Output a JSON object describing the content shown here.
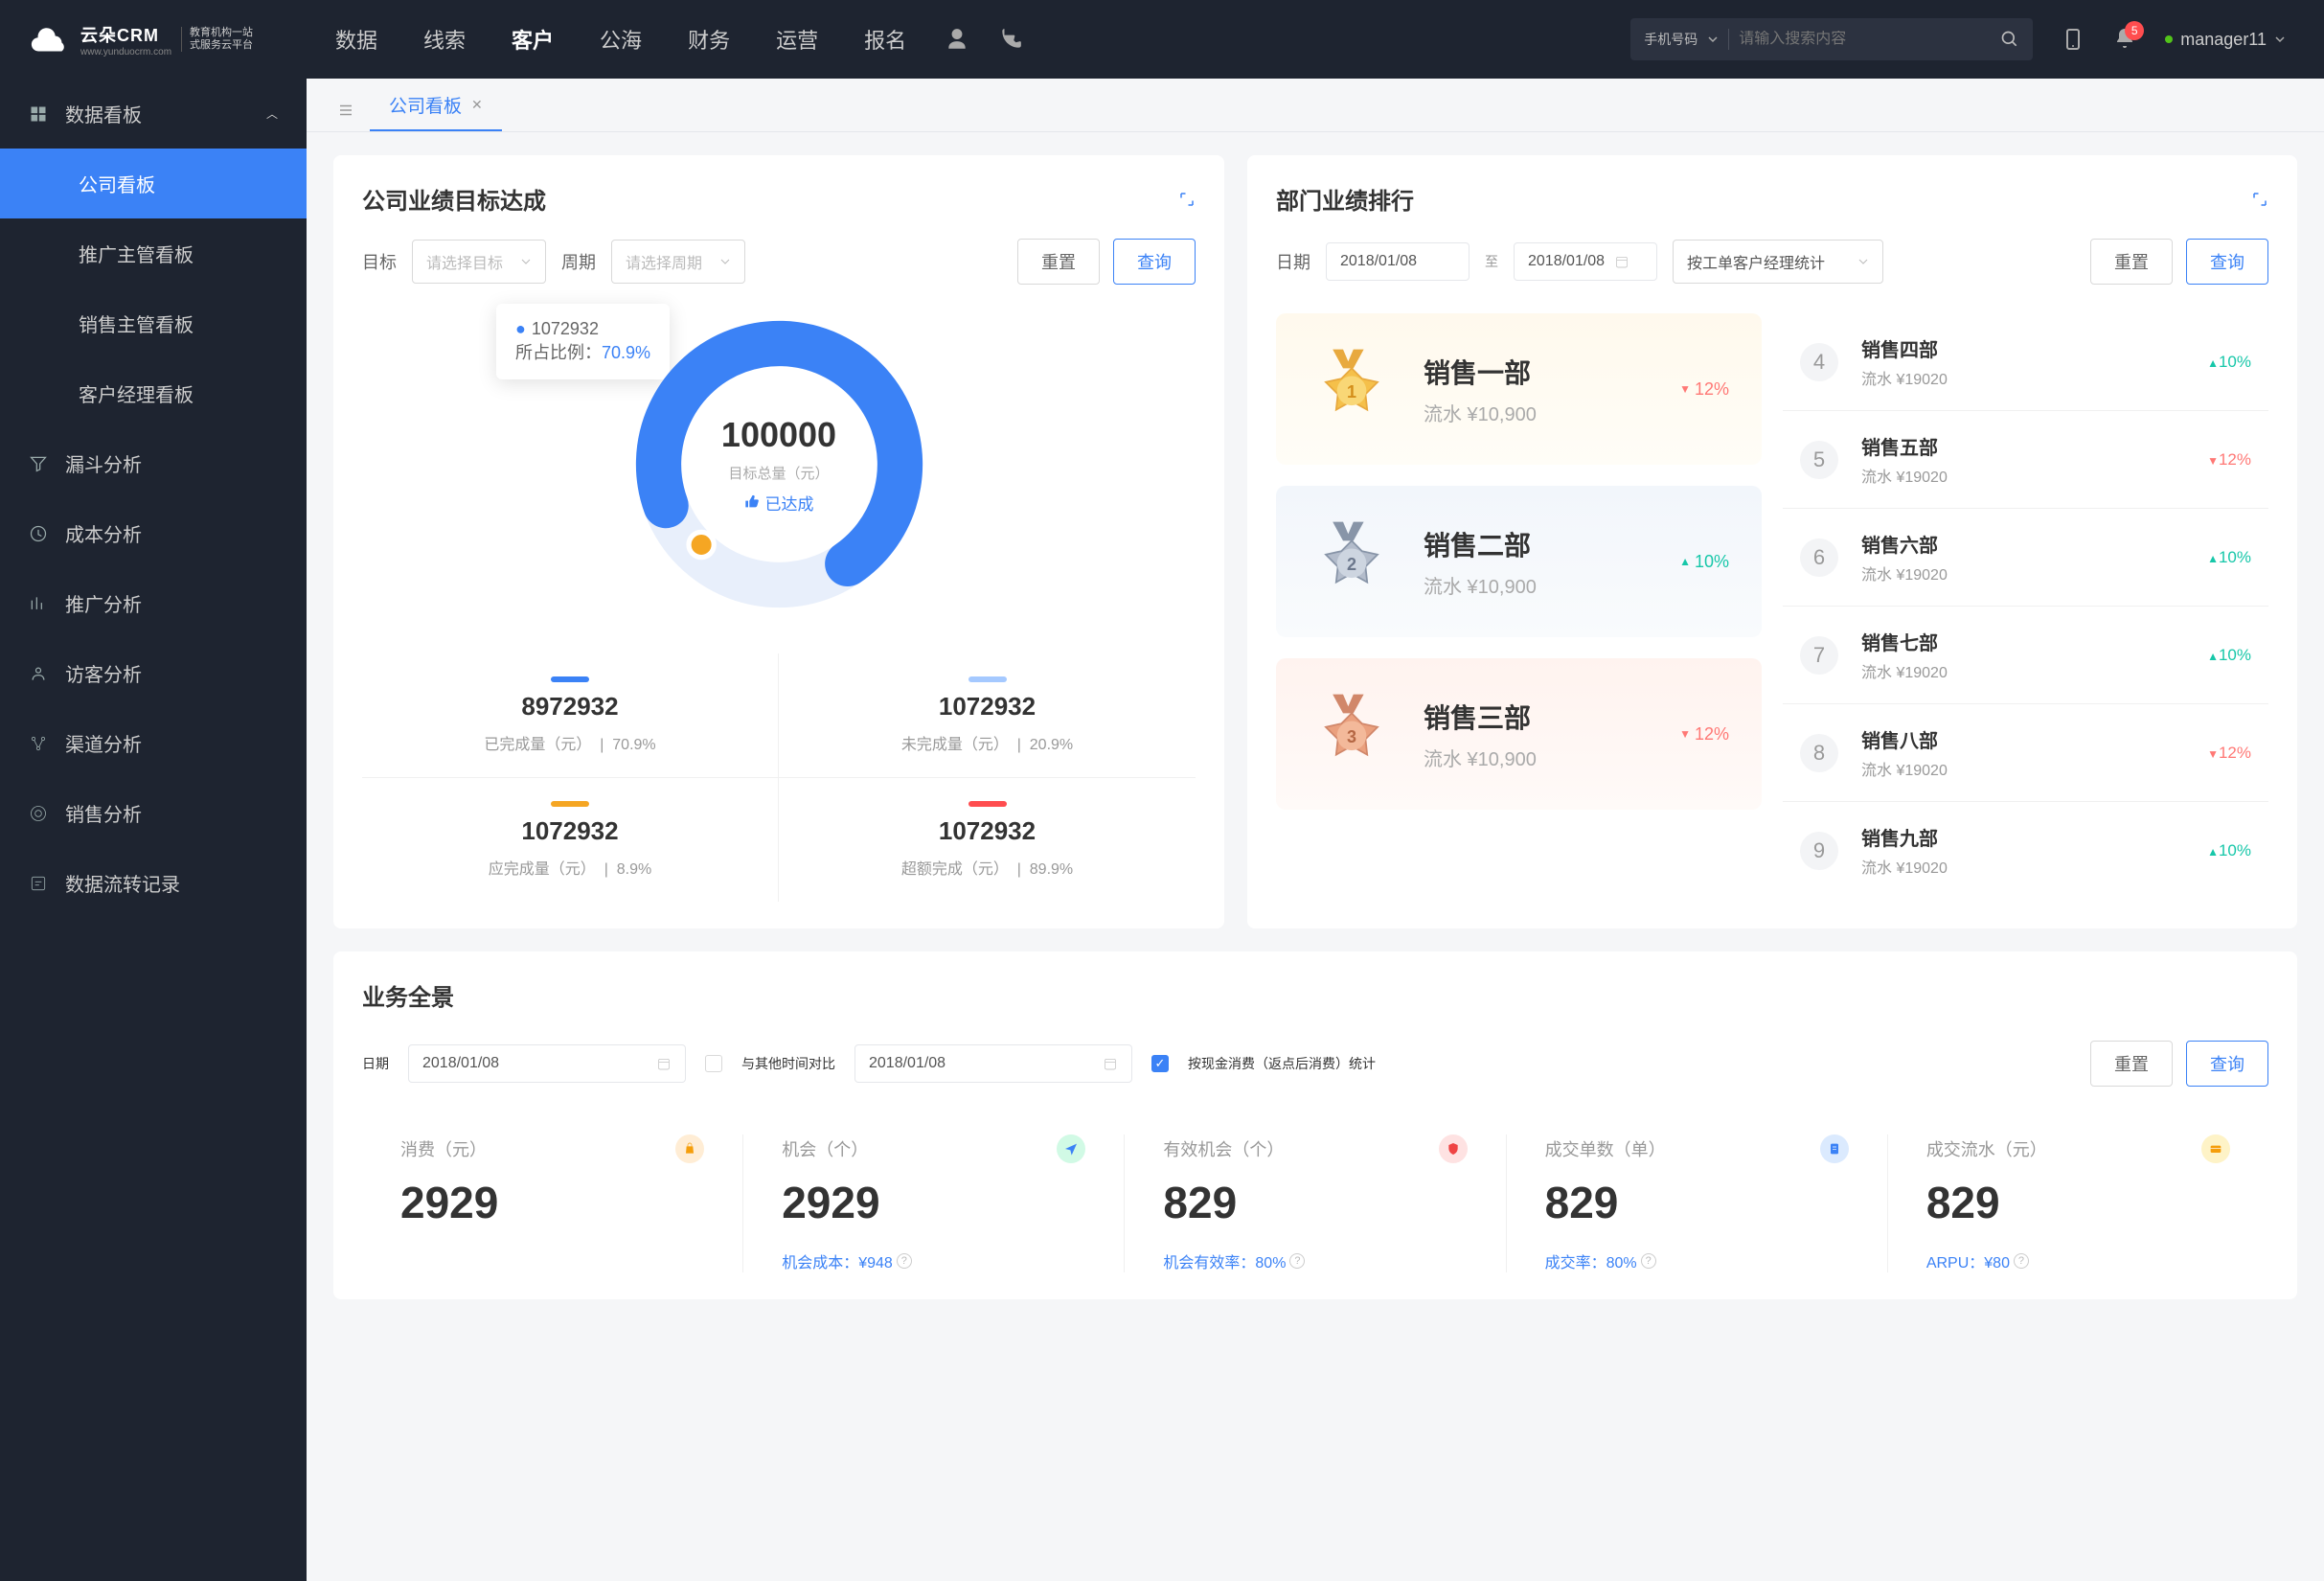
{
  "brand": {
    "name": "云朵CRM",
    "sub1": "教育机构一站",
    "sub2": "式服务云平台",
    "domain": "www.yunduocrm.com"
  },
  "nav": {
    "items": [
      "数据",
      "线索",
      "客户",
      "公海",
      "财务",
      "运营",
      "报名"
    ],
    "search_type": "手机号码",
    "search_placeholder": "请输入搜索内容"
  },
  "notification_count": "5",
  "user": "manager11",
  "sidebar": {
    "group1": {
      "label": "数据看板"
    },
    "subs": [
      "公司看板",
      "推广主管看板",
      "销售主管看板",
      "客户经理看板"
    ],
    "items": [
      "漏斗分析",
      "成本分析",
      "推广分析",
      "访客分析",
      "渠道分析",
      "销售分析",
      "数据流转记录"
    ]
  },
  "tab": {
    "label": "公司看板"
  },
  "goals": {
    "title": "公司业绩目标达成",
    "label_target": "目标",
    "ph_target": "请选择目标",
    "label_period": "周期",
    "ph_period": "请选择周期",
    "btn_reset": "重置",
    "btn_query": "查询",
    "tooltip_value": "1072932",
    "tooltip_ratio_label": "所占比例：",
    "tooltip_ratio": "70.9%",
    "total": "100000",
    "total_label": "目标总量（元）",
    "achieved": "已达成",
    "stats": [
      {
        "value": "8972932",
        "label": "已完成量（元）",
        "pct": "70.9%",
        "color": "bar-blue"
      },
      {
        "value": "1072932",
        "label": "未完成量（元）",
        "pct": "20.9%",
        "color": "bar-lblue"
      },
      {
        "value": "1072932",
        "label": "应完成量（元）",
        "pct": "8.9%",
        "color": "bar-yellow"
      },
      {
        "value": "1072932",
        "label": "超额完成（元）",
        "pct": "89.9%",
        "color": "bar-red"
      }
    ]
  },
  "rank": {
    "title": "部门业绩排行",
    "label_date": "日期",
    "date_from": "2018/01/08",
    "date_to": "2018/01/08",
    "date_sep": "至",
    "selector": "按工单客户经理统计",
    "btn_reset": "重置",
    "btn_query": "查询",
    "top3": [
      {
        "name": "销售一部",
        "sub": "流水 ¥10,900",
        "delta": "12%",
        "dir": "down"
      },
      {
        "name": "销售二部",
        "sub": "流水 ¥10,900",
        "delta": "10%",
        "dir": "up"
      },
      {
        "name": "销售三部",
        "sub": "流水 ¥10,900",
        "delta": "12%",
        "dir": "down"
      }
    ],
    "rest": [
      {
        "num": "4",
        "name": "销售四部",
        "sub": "流水 ¥19020",
        "delta": "10%",
        "dir": "up"
      },
      {
        "num": "5",
        "name": "销售五部",
        "sub": "流水 ¥19020",
        "delta": "12%",
        "dir": "down"
      },
      {
        "num": "6",
        "name": "销售六部",
        "sub": "流水 ¥19020",
        "delta": "10%",
        "dir": "up"
      },
      {
        "num": "7",
        "name": "销售七部",
        "sub": "流水 ¥19020",
        "delta": "10%",
        "dir": "up"
      },
      {
        "num": "8",
        "name": "销售八部",
        "sub": "流水 ¥19020",
        "delta": "12%",
        "dir": "down"
      },
      {
        "num": "9",
        "name": "销售九部",
        "sub": "流水 ¥19020",
        "delta": "10%",
        "dir": "up"
      }
    ]
  },
  "biz": {
    "title": "业务全景",
    "label_date": "日期",
    "date": "2018/01/08",
    "compare_label": "与其他时间对比",
    "date2": "2018/01/08",
    "cash_label": "按现金消费（返点后消费）统计",
    "btn_reset": "重置",
    "btn_query": "查询",
    "metrics": [
      {
        "label": "消费（元）",
        "value": "2929",
        "extra": "",
        "icon": "mic-orange"
      },
      {
        "label": "机会（个）",
        "value": "2929",
        "extra": "机会成本：¥948",
        "icon": "mic-teal"
      },
      {
        "label": "有效机会（个）",
        "value": "829",
        "extra": "机会有效率：80%",
        "icon": "mic-red"
      },
      {
        "label": "成交单数（单）",
        "value": "829",
        "extra": "成交率：80%",
        "icon": "mic-blue"
      },
      {
        "label": "成交流水（元）",
        "value": "829",
        "extra": "ARPU：¥80",
        "icon": "mic-yellow"
      }
    ]
  },
  "chart_data": {
    "type": "pie",
    "title": "公司业绩目标达成",
    "total": 100000,
    "series": [
      {
        "name": "已完成",
        "value": 70.9,
        "color": "#3b82f6"
      },
      {
        "name": "未完成",
        "value": 29.1,
        "color": "#e5ecf9"
      }
    ]
  }
}
